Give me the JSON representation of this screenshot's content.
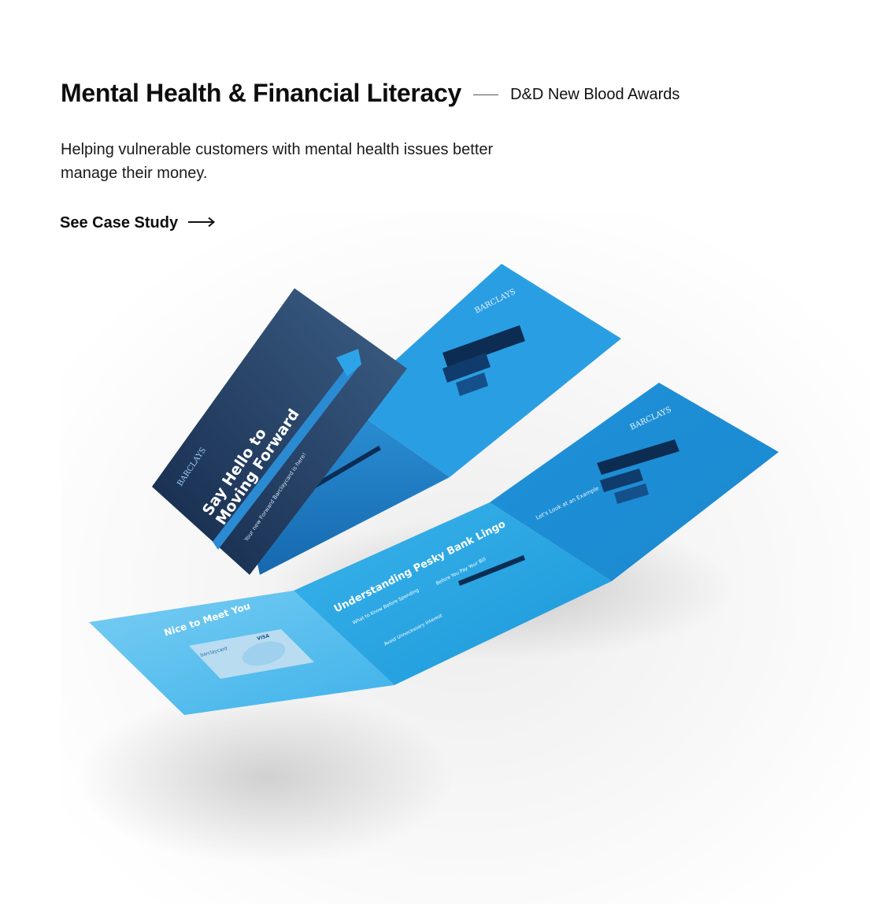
{
  "project": {
    "title": "Mental Health & Financial Literacy",
    "award": "D&D New Blood Awards",
    "description": "Helping vulnerable customers with mental health issues better manage their money.",
    "cta_label": "See Case Study",
    "cta_icon": "arrow-right-icon"
  },
  "mockup": {
    "brand": "BARCLAYS",
    "cover_headline_1": "Say Hello to",
    "cover_headline_2": "Moving Forward",
    "cover_subline": "Your new Forward Barclaycard is here!",
    "panel_heading_1": "Nice to Meet You",
    "panel_heading_2": "Understanding Pesky Bank Lingo",
    "panel_heading_3": "Let's Look at an Example",
    "panel_subheading_1": "What to Know Before Spending",
    "panel_subheading_2": "Before You Pay Your Bill",
    "panel_subheading_3": "Avoid Unnecessary Interest",
    "card_brand": "barclaycard",
    "card_network": "VISA",
    "colors": {
      "cover_dark": "#1f3a5f",
      "panel_blue": "#1f8fd6",
      "panel_light": "#5cc0ef",
      "accent_cyan": "#36a9e6",
      "navy_bar": "#0c2c52"
    }
  }
}
